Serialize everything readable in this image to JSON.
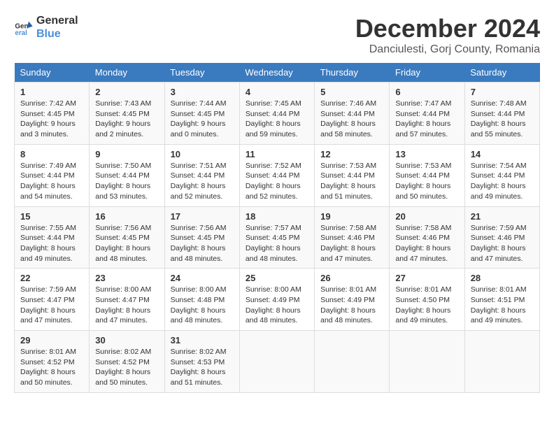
{
  "logo": {
    "line1": "General",
    "line2": "Blue"
  },
  "title": "December 2024",
  "location": "Danciulesti, Gorj County, Romania",
  "days_of_week": [
    "Sunday",
    "Monday",
    "Tuesday",
    "Wednesday",
    "Thursday",
    "Friday",
    "Saturday"
  ],
  "weeks": [
    [
      {
        "day": 1,
        "details": "Sunrise: 7:42 AM\nSunset: 4:45 PM\nDaylight: 9 hours and 3 minutes."
      },
      {
        "day": 2,
        "details": "Sunrise: 7:43 AM\nSunset: 4:45 PM\nDaylight: 9 hours and 2 minutes."
      },
      {
        "day": 3,
        "details": "Sunrise: 7:44 AM\nSunset: 4:45 PM\nDaylight: 9 hours and 0 minutes."
      },
      {
        "day": 4,
        "details": "Sunrise: 7:45 AM\nSunset: 4:44 PM\nDaylight: 8 hours and 59 minutes."
      },
      {
        "day": 5,
        "details": "Sunrise: 7:46 AM\nSunset: 4:44 PM\nDaylight: 8 hours and 58 minutes."
      },
      {
        "day": 6,
        "details": "Sunrise: 7:47 AM\nSunset: 4:44 PM\nDaylight: 8 hours and 57 minutes."
      },
      {
        "day": 7,
        "details": "Sunrise: 7:48 AM\nSunset: 4:44 PM\nDaylight: 8 hours and 55 minutes."
      }
    ],
    [
      {
        "day": 8,
        "details": "Sunrise: 7:49 AM\nSunset: 4:44 PM\nDaylight: 8 hours and 54 minutes."
      },
      {
        "day": 9,
        "details": "Sunrise: 7:50 AM\nSunset: 4:44 PM\nDaylight: 8 hours and 53 minutes."
      },
      {
        "day": 10,
        "details": "Sunrise: 7:51 AM\nSunset: 4:44 PM\nDaylight: 8 hours and 52 minutes."
      },
      {
        "day": 11,
        "details": "Sunrise: 7:52 AM\nSunset: 4:44 PM\nDaylight: 8 hours and 52 minutes."
      },
      {
        "day": 12,
        "details": "Sunrise: 7:53 AM\nSunset: 4:44 PM\nDaylight: 8 hours and 51 minutes."
      },
      {
        "day": 13,
        "details": "Sunrise: 7:53 AM\nSunset: 4:44 PM\nDaylight: 8 hours and 50 minutes."
      },
      {
        "day": 14,
        "details": "Sunrise: 7:54 AM\nSunset: 4:44 PM\nDaylight: 8 hours and 49 minutes."
      }
    ],
    [
      {
        "day": 15,
        "details": "Sunrise: 7:55 AM\nSunset: 4:44 PM\nDaylight: 8 hours and 49 minutes."
      },
      {
        "day": 16,
        "details": "Sunrise: 7:56 AM\nSunset: 4:45 PM\nDaylight: 8 hours and 48 minutes."
      },
      {
        "day": 17,
        "details": "Sunrise: 7:56 AM\nSunset: 4:45 PM\nDaylight: 8 hours and 48 minutes."
      },
      {
        "day": 18,
        "details": "Sunrise: 7:57 AM\nSunset: 4:45 PM\nDaylight: 8 hours and 48 minutes."
      },
      {
        "day": 19,
        "details": "Sunrise: 7:58 AM\nSunset: 4:46 PM\nDaylight: 8 hours and 47 minutes."
      },
      {
        "day": 20,
        "details": "Sunrise: 7:58 AM\nSunset: 4:46 PM\nDaylight: 8 hours and 47 minutes."
      },
      {
        "day": 21,
        "details": "Sunrise: 7:59 AM\nSunset: 4:46 PM\nDaylight: 8 hours and 47 minutes."
      }
    ],
    [
      {
        "day": 22,
        "details": "Sunrise: 7:59 AM\nSunset: 4:47 PM\nDaylight: 8 hours and 47 minutes."
      },
      {
        "day": 23,
        "details": "Sunrise: 8:00 AM\nSunset: 4:47 PM\nDaylight: 8 hours and 47 minutes."
      },
      {
        "day": 24,
        "details": "Sunrise: 8:00 AM\nSunset: 4:48 PM\nDaylight: 8 hours and 48 minutes."
      },
      {
        "day": 25,
        "details": "Sunrise: 8:00 AM\nSunset: 4:49 PM\nDaylight: 8 hours and 48 minutes."
      },
      {
        "day": 26,
        "details": "Sunrise: 8:01 AM\nSunset: 4:49 PM\nDaylight: 8 hours and 48 minutes."
      },
      {
        "day": 27,
        "details": "Sunrise: 8:01 AM\nSunset: 4:50 PM\nDaylight: 8 hours and 49 minutes."
      },
      {
        "day": 28,
        "details": "Sunrise: 8:01 AM\nSunset: 4:51 PM\nDaylight: 8 hours and 49 minutes."
      }
    ],
    [
      {
        "day": 29,
        "details": "Sunrise: 8:01 AM\nSunset: 4:52 PM\nDaylight: 8 hours and 50 minutes."
      },
      {
        "day": 30,
        "details": "Sunrise: 8:02 AM\nSunset: 4:52 PM\nDaylight: 8 hours and 50 minutes."
      },
      {
        "day": 31,
        "details": "Sunrise: 8:02 AM\nSunset: 4:53 PM\nDaylight: 8 hours and 51 minutes."
      },
      null,
      null,
      null,
      null
    ]
  ]
}
